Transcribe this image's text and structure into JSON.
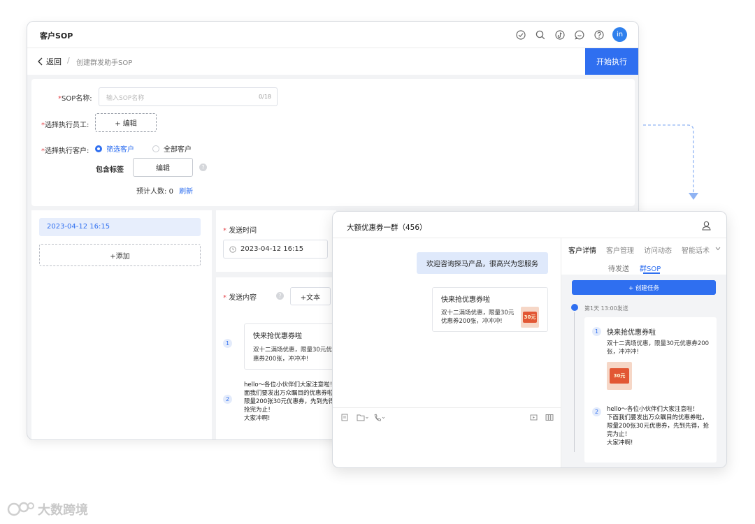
{
  "back_window": {
    "title": "客户SOP",
    "avatar_text": "in",
    "breadcrumb": {
      "back_label": "返回",
      "separator": "/",
      "current": "创建群发助手SOP"
    },
    "execute_button": "开始执行",
    "form": {
      "sop_name_label": "SOP名称:",
      "sop_name_placeholder": "输入SOP名称",
      "sop_name_count": "0/18",
      "employee_label": "选择执行员工:",
      "employee_edit": "+ 编辑",
      "customer_label": "选择执行客户:",
      "customer_options": [
        "筛选客户",
        "全部客户"
      ],
      "tag_label": "包含标签",
      "tag_edit": "编辑",
      "estimate_label": "预计人数:",
      "estimate_value": "0",
      "refresh": "刷新",
      "required_mark": "*"
    },
    "left_panel": {
      "date_item": "2023-04-12 16:15",
      "add_button": "+添加"
    },
    "send_time": {
      "label": "发送时间",
      "value": "2023-04-12 16:15"
    },
    "send_content": {
      "label": "发送内容",
      "text_button": "+文本",
      "items": [
        {
          "index": "1",
          "title": "快来抢优惠券啦",
          "desc": "双十二满场优惠，限量30元优惠券200张，冲冲冲!"
        },
        {
          "index": "2",
          "text": "hello～各位小伙伴们大家注意啦！下面我们要发出万众瞩目的优惠券啦，限量200张30元优惠券，先到先得，抢完为止！\n大家冲啊!"
        }
      ]
    }
  },
  "front_window": {
    "chat_title": "大额优惠券一群（456）",
    "messages": {
      "welcome": "欢迎咨询探马产品，很高兴为您服务",
      "card_title": "快来抢优惠券啦",
      "card_desc": "双十二满场优惠，限量30元优惠券200张，冲冲冲!",
      "coupon_text": "30元"
    },
    "side_tabs": [
      "客户详情",
      "客户管理",
      "访问动态",
      "智能话术"
    ],
    "sub_tabs": [
      "待发送",
      "群SOP"
    ],
    "create_task": "+ 创建任务",
    "day_label": "第1天  13:00发送",
    "task_items": [
      {
        "index": "1",
        "title": "快来抢优惠券啦",
        "desc": "双十二满场优惠，限量30元优惠券200张，冲冲冲!"
      },
      {
        "index": "2",
        "text": "hello～各位小伙伴们大家注意啦！\n下面我们要发出万众瞩目的优惠券啦，限量200张30元优惠券，先到先得，抢完为止！\n大家冲啊!"
      }
    ]
  },
  "watermark": "大数跨境",
  "colors": {
    "accent": "#2f6ff0",
    "required": "#e5484d"
  }
}
